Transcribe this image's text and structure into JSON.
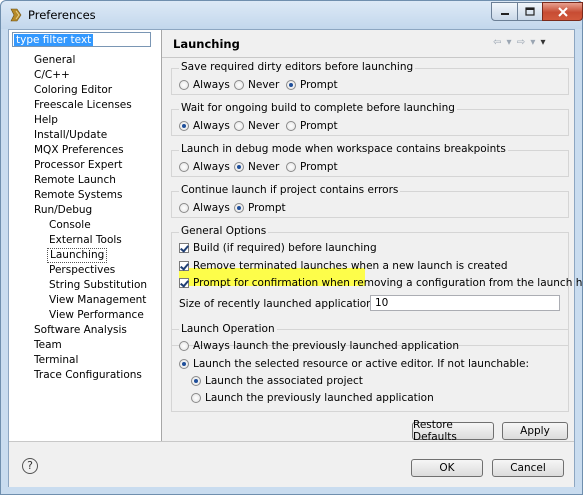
{
  "window": {
    "title": "Preferences"
  },
  "sidebar": {
    "filter_text": "type filter text",
    "items": [
      {
        "label": "General",
        "level": 1
      },
      {
        "label": "C/C++",
        "level": 1
      },
      {
        "label": "Coloring Editor",
        "level": 1
      },
      {
        "label": "Freescale Licenses",
        "level": 1
      },
      {
        "label": "Help",
        "level": 1
      },
      {
        "label": "Install/Update",
        "level": 1
      },
      {
        "label": "MQX Preferences",
        "level": 1
      },
      {
        "label": "Processor Expert",
        "level": 1
      },
      {
        "label": "Remote Launch",
        "level": 1
      },
      {
        "label": "Remote Systems",
        "level": 1
      },
      {
        "label": "Run/Debug",
        "level": 1
      },
      {
        "label": "Console",
        "level": 2
      },
      {
        "label": "External Tools",
        "level": 2
      },
      {
        "label": "Launching",
        "level": 2,
        "selected": true
      },
      {
        "label": "Perspectives",
        "level": 2
      },
      {
        "label": "String Substitution",
        "level": 2
      },
      {
        "label": "View Management",
        "level": 2
      },
      {
        "label": "View Performance",
        "level": 2
      },
      {
        "label": "Software Analysis",
        "level": 1
      },
      {
        "label": "Team",
        "level": 1
      },
      {
        "label": "Terminal",
        "level": 1
      },
      {
        "label": "Trace Configurations",
        "level": 1
      }
    ]
  },
  "page": {
    "title": "Launching",
    "groups": {
      "save_dirty": {
        "label": "Save required dirty editors before launching",
        "options": [
          "Always",
          "Never",
          "Prompt"
        ],
        "selected": "Prompt"
      },
      "wait_build": {
        "label": "Wait for ongoing build to complete before launching",
        "options": [
          "Always",
          "Never",
          "Prompt"
        ],
        "selected": "Always"
      },
      "debug_mode": {
        "label": "Launch in debug mode when workspace contains breakpoints",
        "options": [
          "Always",
          "Never",
          "Prompt"
        ],
        "selected": "Never"
      },
      "errors": {
        "label": "Continue launch if project contains errors",
        "options": [
          "Always",
          "Prompt"
        ],
        "selected": "Prompt"
      }
    },
    "general": {
      "label": "General Options",
      "build_before": "Build (if required) before launching",
      "remove_terminated": "Remove terminated launches when a new launch is created",
      "prompt_confirm": "Prompt for confirmation when removing a configuration from the launch history",
      "size_label": "Size of recently launched applications list:",
      "size_value": "10"
    },
    "launch_operation": {
      "label": "Launch Operation",
      "always_previous": "Always launch the previously launched application",
      "launch_selected": "Launch the selected resource or active editor. If not launchable:",
      "launch_project": "Launch the associated project",
      "launch_previous": "Launch the previously launched application"
    },
    "restore_defaults": "Restore Defaults",
    "apply": "Apply"
  },
  "footer": {
    "ok": "OK",
    "cancel": "Cancel",
    "help": "?"
  },
  "colors": {
    "highlight": "#fdfd4a",
    "selection": "#3399ff",
    "close_button": "#c74c33"
  }
}
